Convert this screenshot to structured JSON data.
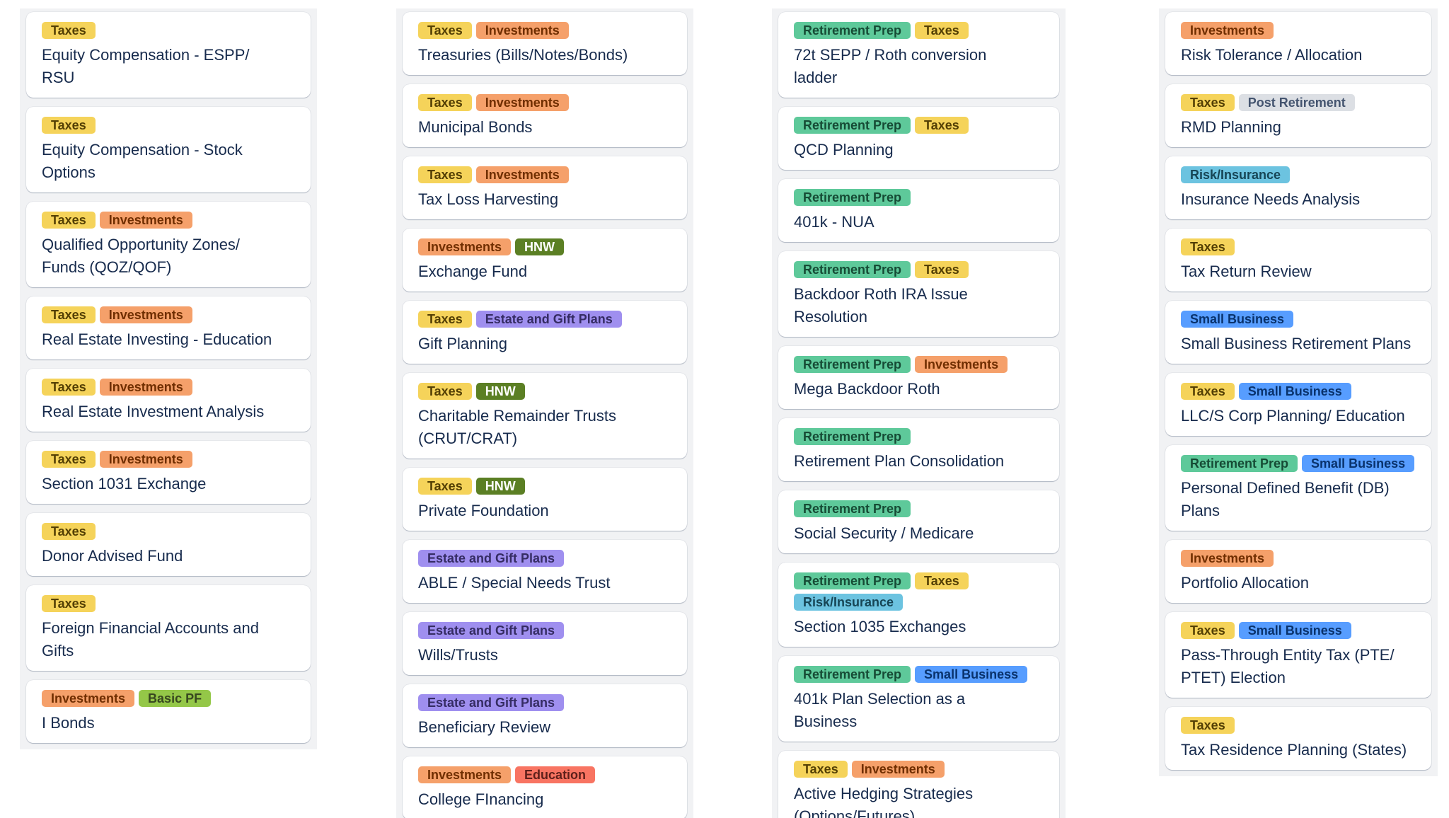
{
  "label_styles": {
    "Taxes": {
      "bg": "#f5d35a",
      "fg": "#533f04"
    },
    "Investments": {
      "bg": "#f5a06a",
      "fg": "#702e00"
    },
    "HNW": {
      "bg": "#5b7f24",
      "fg": "#ffffff"
    },
    "Basic PF": {
      "bg": "#94c748",
      "fg": "#37471f"
    },
    "Estate and Gift Plans": {
      "bg": "#9f8fef",
      "fg": "#352c63"
    },
    "Education": {
      "bg": "#f87462",
      "fg": "#5d1f1a"
    },
    "Retirement Prep": {
      "bg": "#5ec99a",
      "fg": "#164b35"
    },
    "Risk/Insurance": {
      "bg": "#6cc3e0",
      "fg": "#164555"
    },
    "Post Retirement": {
      "bg": "#dcdfe4",
      "fg": "#44546f"
    },
    "Small Business": {
      "bg": "#579dff",
      "fg": "#09326c"
    }
  },
  "columns": [
    {
      "cards": [
        {
          "labels": [
            "Taxes"
          ],
          "title": "Equity Compensation - ESPP/ RSU"
        },
        {
          "labels": [
            "Taxes"
          ],
          "title": "Equity Compensation - Stock Options"
        },
        {
          "labels": [
            "Taxes",
            "Investments"
          ],
          "title": "Qualified Opportunity Zones/ Funds (QOZ/QOF)"
        },
        {
          "labels": [
            "Taxes",
            "Investments"
          ],
          "title": "Real Estate Investing - Education"
        },
        {
          "labels": [
            "Taxes",
            "Investments"
          ],
          "title": "Real Estate Investment Analysis"
        },
        {
          "labels": [
            "Taxes",
            "Investments"
          ],
          "title": "Section 1031 Exchange"
        },
        {
          "labels": [
            "Taxes"
          ],
          "title": "Donor Advised Fund"
        },
        {
          "labels": [
            "Taxes"
          ],
          "title": "Foreign Financial Accounts and Gifts"
        },
        {
          "labels": [
            "Investments",
            "Basic PF"
          ],
          "title": "I Bonds"
        }
      ]
    },
    {
      "cards": [
        {
          "labels": [
            "Taxes",
            "Investments"
          ],
          "title": "Treasuries (Bills/Notes/Bonds)"
        },
        {
          "labels": [
            "Taxes",
            "Investments"
          ],
          "title": "Municipal Bonds"
        },
        {
          "labels": [
            "Taxes",
            "Investments"
          ],
          "title": "Tax Loss Harvesting"
        },
        {
          "labels": [
            "Investments",
            "HNW"
          ],
          "title": "Exchange Fund"
        },
        {
          "labels": [
            "Taxes",
            "Estate and Gift Plans"
          ],
          "title": "Gift Planning"
        },
        {
          "labels": [
            "Taxes",
            "HNW"
          ],
          "title": "Charitable Remainder Trusts (CRUT/CRAT)"
        },
        {
          "labels": [
            "Taxes",
            "HNW"
          ],
          "title": "Private Foundation"
        },
        {
          "labels": [
            "Estate and Gift Plans"
          ],
          "title": "ABLE / Special Needs Trust"
        },
        {
          "labels": [
            "Estate and Gift Plans"
          ],
          "title": "Wills/Trusts"
        },
        {
          "labels": [
            "Estate and Gift Plans"
          ],
          "title": "Beneficiary Review"
        },
        {
          "labels": [
            "Investments",
            "Education"
          ],
          "title": "College FInancing"
        }
      ]
    },
    {
      "cards": [
        {
          "labels": [
            "Retirement Prep",
            "Taxes"
          ],
          "title": "72t SEPP / Roth conversion ladder"
        },
        {
          "labels": [
            "Retirement Prep",
            "Taxes"
          ],
          "title": "QCD Planning"
        },
        {
          "labels": [
            "Retirement Prep"
          ],
          "title": "401k - NUA"
        },
        {
          "labels": [
            "Retirement Prep",
            "Taxes"
          ],
          "title": "Backdoor Roth IRA Issue Resolution"
        },
        {
          "labels": [
            "Retirement Prep",
            "Investments"
          ],
          "title": "Mega Backdoor Roth"
        },
        {
          "labels": [
            "Retirement Prep"
          ],
          "title": "Retirement Plan Consolidation"
        },
        {
          "labels": [
            "Retirement Prep"
          ],
          "title": "Social Security / Medicare"
        },
        {
          "labels": [
            "Retirement Prep",
            "Taxes",
            "Risk/Insurance"
          ],
          "title": "Section 1035 Exchanges"
        },
        {
          "labels": [
            "Retirement Prep",
            "Small Business"
          ],
          "title": "401k Plan Selection as a Business"
        },
        {
          "labels": [
            "Taxes",
            "Investments"
          ],
          "title": "Active Hedging Strategies (Options/Futures)"
        }
      ]
    },
    {
      "cards": [
        {
          "labels": [
            "Investments"
          ],
          "title": "Risk Tolerance / Allocation"
        },
        {
          "labels": [
            "Taxes",
            "Post Retirement"
          ],
          "title": "RMD Planning"
        },
        {
          "labels": [
            "Risk/Insurance"
          ],
          "title": "Insurance Needs Analysis"
        },
        {
          "labels": [
            "Taxes"
          ],
          "title": "Tax Return Review"
        },
        {
          "labels": [
            "Small Business"
          ],
          "title": "Small Business Retirement Plans"
        },
        {
          "labels": [
            "Taxes",
            "Small Business"
          ],
          "title": "LLC/S Corp Planning/ Education"
        },
        {
          "labels": [
            "Retirement Prep",
            "Small Business"
          ],
          "title": "Personal Defined Benefit (DB) Plans"
        },
        {
          "labels": [
            "Investments"
          ],
          "title": "Portfolio Allocation"
        },
        {
          "labels": [
            "Taxes",
            "Small Business"
          ],
          "title": "Pass-Through Entity Tax (PTE/ PTET) Election"
        },
        {
          "labels": [
            "Taxes"
          ],
          "title": "Tax Residence Planning (States)"
        }
      ]
    }
  ]
}
